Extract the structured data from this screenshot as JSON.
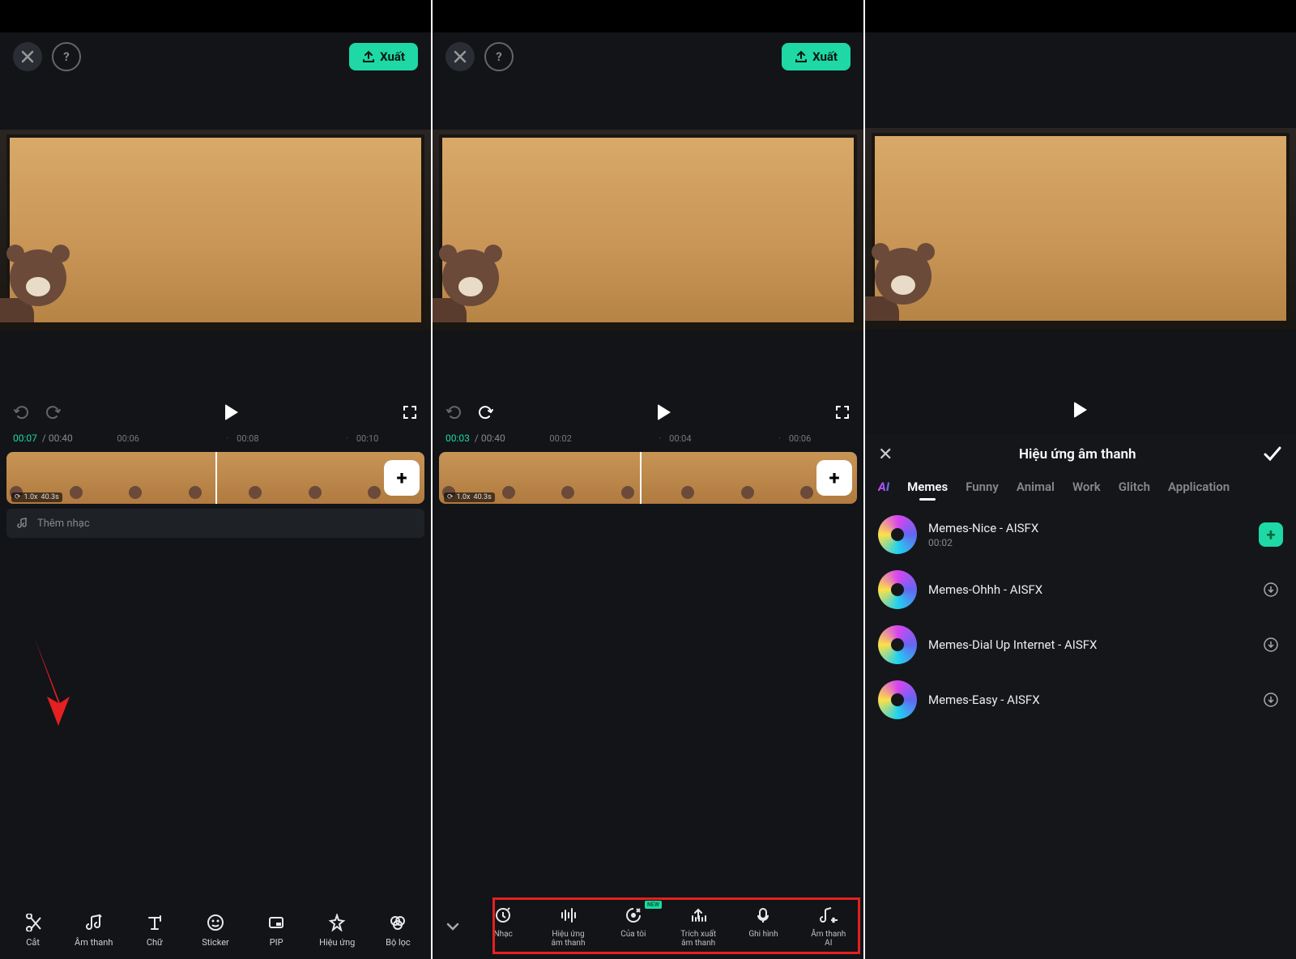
{
  "export_label": "Xuất",
  "panel1": {
    "time_current": "00:07",
    "time_total": "/ 00:40",
    "marks": [
      "00:06",
      "00:08",
      "00:10"
    ],
    "speed_badge": "1.0x",
    "duration_badge": "40.3s",
    "music_placeholder": "Thêm nhạc",
    "playhead_pct": 50,
    "tools": [
      {
        "label": "Cắt",
        "name": "cut"
      },
      {
        "label": "Âm thanh",
        "name": "audio"
      },
      {
        "label": "Chữ",
        "name": "text"
      },
      {
        "label": "Sticker",
        "name": "sticker"
      },
      {
        "label": "PIP",
        "name": "pip"
      },
      {
        "label": "Hiệu ứng",
        "name": "effects"
      },
      {
        "label": "Bộ lọc",
        "name": "filter"
      }
    ]
  },
  "panel2": {
    "time_current": "00:03",
    "time_total": "/ 00:40",
    "marks": [
      "00:02",
      "00:04",
      "00:06"
    ],
    "speed_badge": "1.0x",
    "duration_badge": "40.3s",
    "playhead_pct": 48,
    "subtools": [
      {
        "label": "Nhạc",
        "name": "music"
      },
      {
        "label": "Hiệu ứng\nâm thanh",
        "name": "sound-fx"
      },
      {
        "label": "Của tôi",
        "name": "mine",
        "new": "NEW"
      },
      {
        "label": "Trích xuất\nâm thanh",
        "name": "extract"
      },
      {
        "label": "Ghi hình",
        "name": "record"
      },
      {
        "label": "Âm thanh\nAI",
        "name": "ai-audio"
      }
    ]
  },
  "panel3": {
    "header_title": "Hiệu ứng âm thanh",
    "tabs": [
      {
        "label": "AI",
        "name": "ai",
        "style": "ai"
      },
      {
        "label": "Memes",
        "name": "memes",
        "active": true
      },
      {
        "label": "Funny",
        "name": "funny"
      },
      {
        "label": "Animal",
        "name": "animal"
      },
      {
        "label": "Work",
        "name": "work"
      },
      {
        "label": "Glitch",
        "name": "glitch"
      },
      {
        "label": "Application",
        "name": "application"
      }
    ],
    "items": [
      {
        "name": "Memes-Nice - AISFX",
        "duration": "00:02",
        "action": "add"
      },
      {
        "name": "Memes-Ohhh - AISFX",
        "action": "download"
      },
      {
        "name": "Memes-Dial Up Internet - AISFX",
        "action": "download"
      },
      {
        "name": "Memes-Easy - AISFX",
        "action": "download"
      }
    ]
  }
}
